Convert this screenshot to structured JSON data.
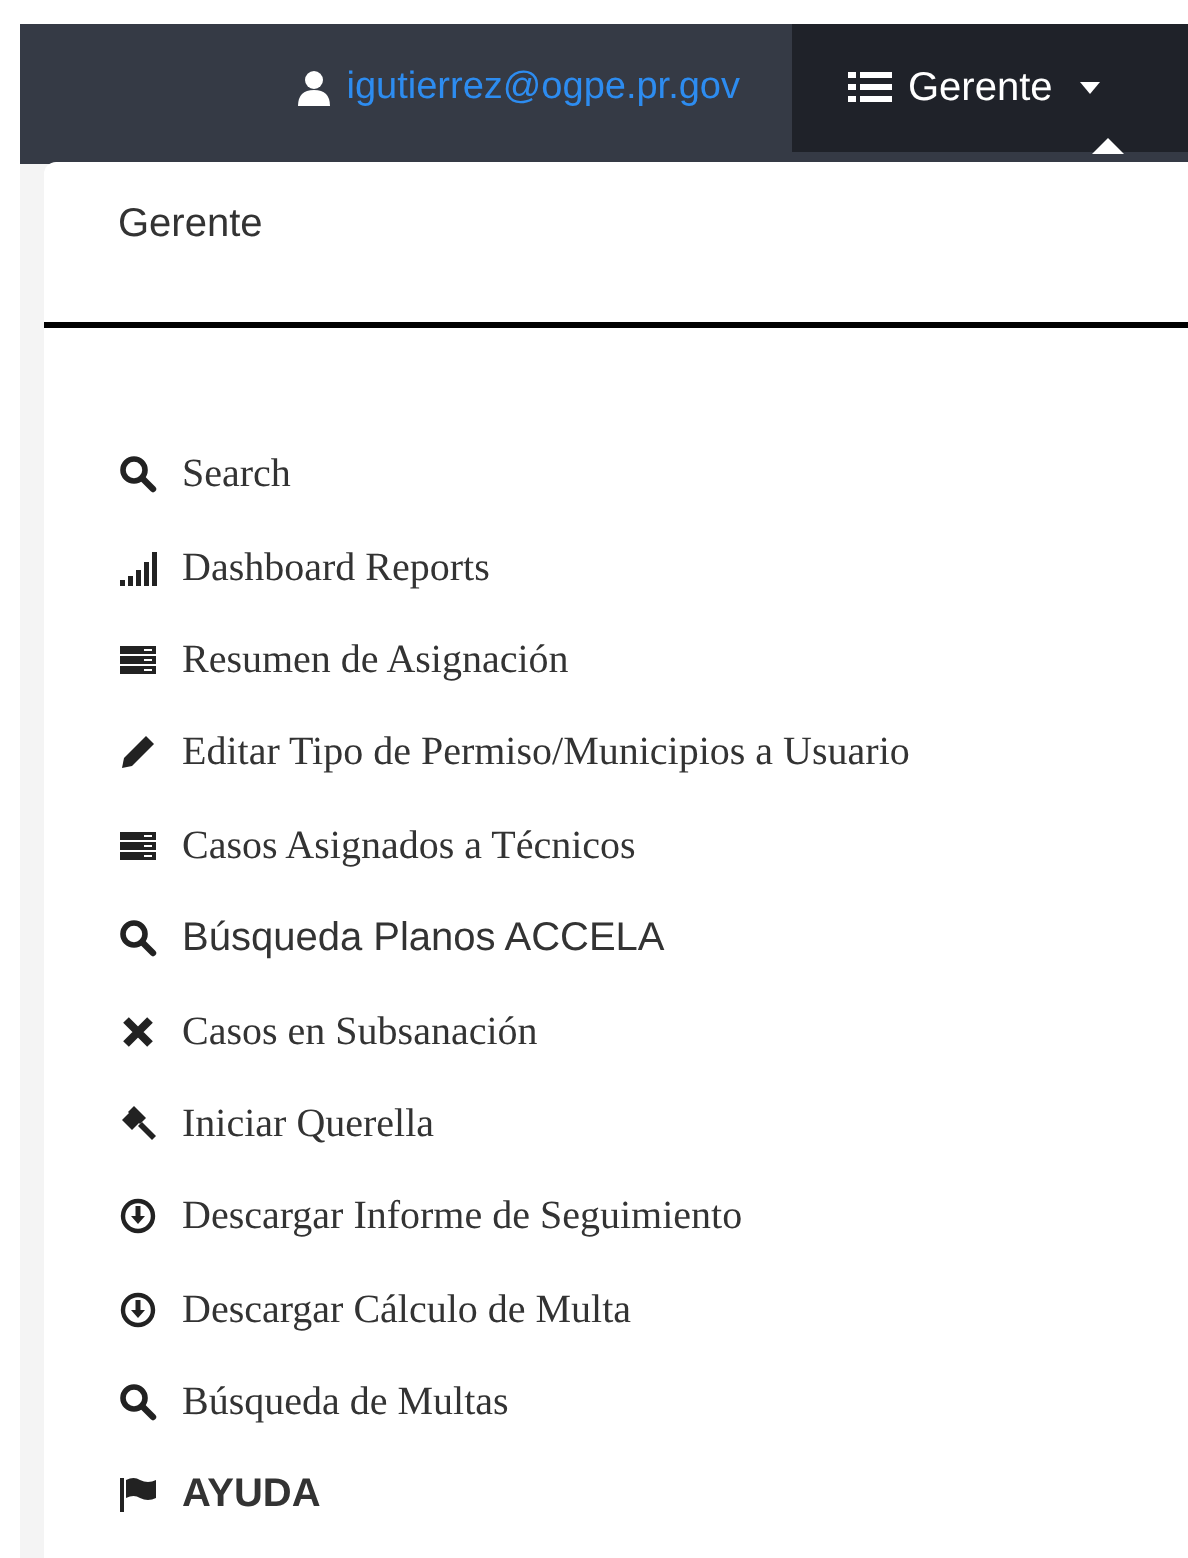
{
  "navbar": {
    "user_email": "igutierrez@ogpe.pr.gov",
    "menu_toggle": {
      "label": "Gerente",
      "expanded": true
    }
  },
  "dropdown": {
    "header": "Gerente",
    "items": [
      {
        "label": "Search",
        "kind": "search",
        "serif": true,
        "bold": false
      },
      {
        "label": "Dashboard Reports",
        "kind": "signal",
        "serif": true,
        "bold": false
      },
      {
        "label": "Resumen de Asignación",
        "kind": "server",
        "serif": true,
        "bold": false
      },
      {
        "label": "Editar Tipo de Permiso/Municipios a Usuario",
        "kind": "pencil",
        "serif": true,
        "bold": false
      },
      {
        "label": "Casos Asignados a Técnicos",
        "kind": "server",
        "serif": true,
        "bold": false
      },
      {
        "label": "Búsqueda Planos ACCELA",
        "kind": "search",
        "serif": false,
        "bold": false
      },
      {
        "label": "Casos en Subsanación",
        "kind": "cross",
        "serif": true,
        "bold": false
      },
      {
        "label": "Iniciar Querella",
        "kind": "gavel",
        "serif": true,
        "bold": false
      },
      {
        "label": "Descargar Informe de Seguimiento",
        "kind": "download",
        "serif": true,
        "bold": false
      },
      {
        "label": "Descargar Cálculo de Multa",
        "kind": "download",
        "serif": true,
        "bold": false
      },
      {
        "label": "Búsqueda de Multas",
        "kind": "search",
        "serif": true,
        "bold": false
      },
      {
        "label": "AYUDA",
        "kind": "flag",
        "serif": false,
        "bold": true
      }
    ]
  }
}
